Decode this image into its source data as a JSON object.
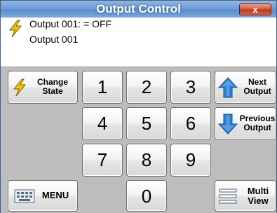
{
  "window": {
    "title": "Output Control",
    "close_label": "x"
  },
  "status": {
    "line1": "Output 001: = OFF",
    "line2": "Output 001"
  },
  "keypad": {
    "digits": [
      "1",
      "2",
      "3",
      "4",
      "5",
      "6",
      "7",
      "8",
      "9",
      "0"
    ],
    "change_state": {
      "line1": "Change",
      "line2": "State"
    },
    "next_output": {
      "line1": "Next",
      "line2": "Output"
    },
    "previous_output": {
      "line1": "Previous",
      "line2": "Output"
    },
    "menu": "MENU",
    "multi_view": {
      "line1": "Multi",
      "line2": "View"
    }
  },
  "colors": {
    "title_bar": "#6f9fd8",
    "close_button": "#c0391b",
    "keypad_bg": "#bdbdbd",
    "arrow_blue": "#2f7fd6",
    "bolt_yellow": "#f2c200"
  },
  "icons": [
    "lightning-icon",
    "arrow-up-icon",
    "arrow-down-icon",
    "keyboard-icon",
    "list-icon"
  ]
}
